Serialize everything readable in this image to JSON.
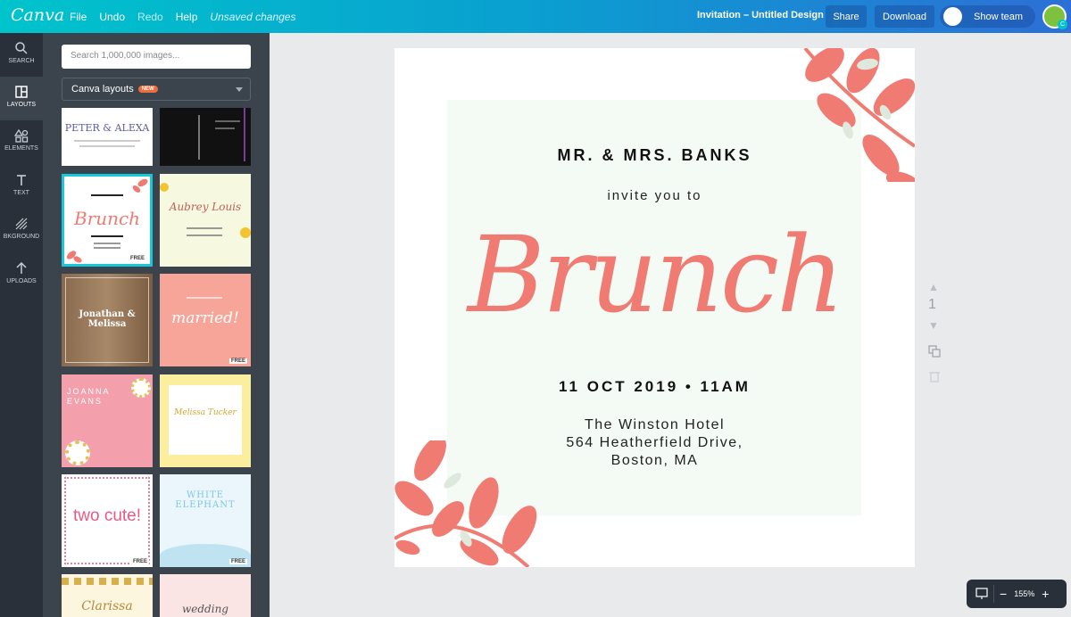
{
  "topbar": {
    "logo": "Canva",
    "menu": [
      "File",
      "Undo",
      "Redo",
      "Help"
    ],
    "unsaved": "Unsaved changes",
    "doc_title": "Invitation – Untitled Design",
    "share": "Share",
    "download": "Download",
    "show_team": "Show team",
    "avatar_initial": "C"
  },
  "rail": {
    "items": [
      {
        "label": "SEARCH",
        "icon": "search-icon"
      },
      {
        "label": "LAYOUTS",
        "icon": "layouts-icon"
      },
      {
        "label": "ELEMENTS",
        "icon": "elements-icon"
      },
      {
        "label": "TEXT",
        "icon": "text-icon"
      },
      {
        "label": "BKGROUND",
        "icon": "background-icon"
      },
      {
        "label": "UPLOADS",
        "icon": "uploads-icon"
      }
    ]
  },
  "panel": {
    "search_placeholder": "Search 1,000,000 images...",
    "dropdown_label": "Canva layouts",
    "new_badge": "NEW",
    "free_label": "FREE",
    "thumbs": [
      {
        "text": "PETER & ALEXA"
      },
      {
        "text": ""
      },
      {
        "text": "Brunch"
      },
      {
        "text": "Aubrey Louis"
      },
      {
        "text": "Jonathan & Melissa"
      },
      {
        "text": "married!"
      },
      {
        "text": "JOANNA EVANS"
      },
      {
        "text": "Melissa Tucker"
      },
      {
        "text": "two cute!"
      },
      {
        "text": "WHITE ELEPHANT"
      },
      {
        "text": "Clarissa"
      },
      {
        "text": "wedding"
      }
    ]
  },
  "design": {
    "names": "MR. & MRS. BANKS",
    "invite": "invite you to",
    "title": "Brunch",
    "date": "11 OCT 2019 • 11AM",
    "venue_line1": "The Winston Hotel",
    "venue_line2": "564 Heatherfield Drive,",
    "venue_line3": "Boston, MA"
  },
  "page_number": "1",
  "zoom": "155%",
  "colors": {
    "accent_coral": "#f07b73",
    "topbar_start": "#00c4cc",
    "topbar_end": "#2d6fd6",
    "mint": "#f4fbf5"
  }
}
